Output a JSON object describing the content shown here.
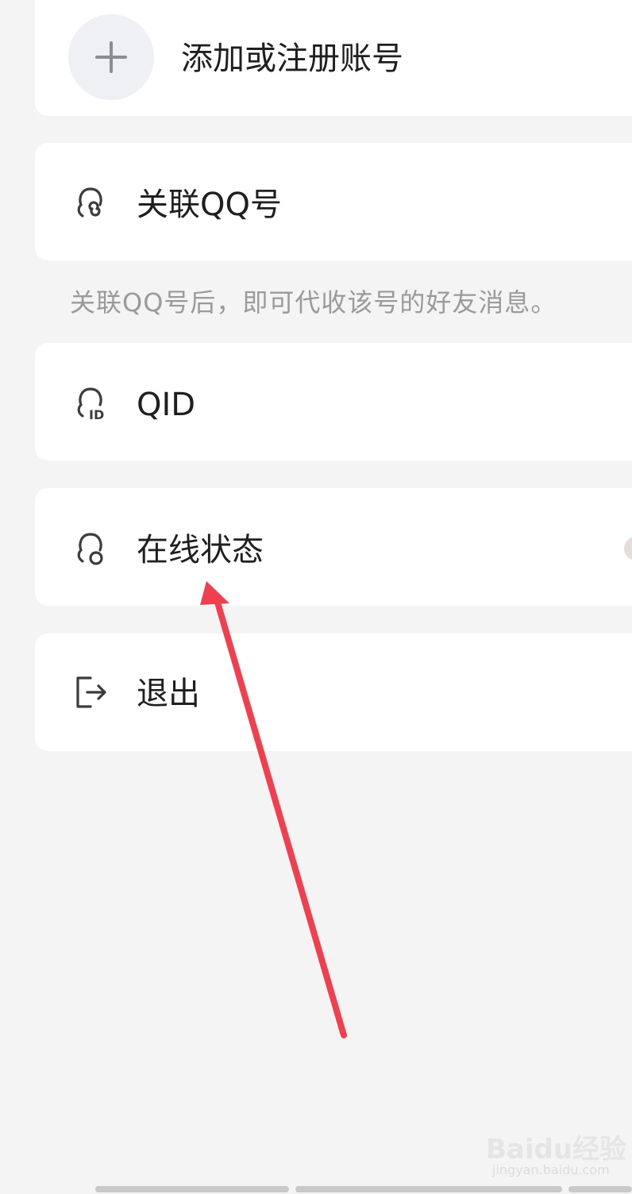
{
  "account": {
    "add_label": "添加或注册账号",
    "add_icon": "plus-icon"
  },
  "menu": {
    "link_qq": {
      "label": "关联QQ号",
      "icon": "link-account-icon"
    },
    "link_hint": "关联QQ号后，即可代收该号的好友消息。",
    "qid": {
      "label": "QID",
      "icon": "id-icon"
    },
    "online_status": {
      "label": "在线状态",
      "icon": "status-icon"
    },
    "logout": {
      "label": "退出",
      "icon": "logout-icon"
    }
  },
  "annotation": {
    "arrow_color": "#f04050"
  },
  "watermark": {
    "main": "Baidu经验",
    "sub": "jingyan.baidu.com"
  }
}
